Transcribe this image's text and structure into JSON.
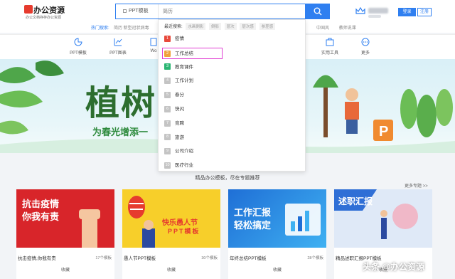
{
  "header": {
    "logo_text": "办公资源",
    "logo_sub": "办公文档存存办公资源",
    "search_category": "PPT模板",
    "search_placeholder": "简历",
    "login_label": "登录",
    "register_label": "注册"
  },
  "hot_search": {
    "label": "热门搜索:",
    "items": "简历  新型冠状病毒",
    "right_items": [
      "中国风",
      "教师说课"
    ]
  },
  "nav": {
    "items": [
      {
        "label": "PPT模板",
        "icon": "ppt-icon"
      },
      {
        "label": "PPT图表",
        "icon": "chart-icon"
      },
      {
        "label": "Wo",
        "icon": "word-icon"
      },
      {
        "label": "实用工具",
        "icon": "tools-icon"
      },
      {
        "label": "更多",
        "icon": "more-icon"
      }
    ]
  },
  "dropdown": {
    "recent_label": "最近搜索:",
    "recent_tags": [
      "水画倒影",
      "倒影",
      "层次",
      "层次感",
      "参差感"
    ],
    "items": [
      {
        "num": "1",
        "label": "疫情",
        "color": "#e84a3c"
      },
      {
        "num": "2",
        "label": "工作总结",
        "color": "#f0a23a"
      },
      {
        "num": "3",
        "label": "教育课件",
        "color": "#2bb673"
      },
      {
        "num": "4",
        "label": "工作计划",
        "color": "#c4c4c4"
      },
      {
        "num": "5",
        "label": "春分",
        "color": "#c4c4c4"
      },
      {
        "num": "6",
        "label": "快闪",
        "color": "#c4c4c4"
      },
      {
        "num": "7",
        "label": "竞聘",
        "color": "#c4c4c4"
      },
      {
        "num": "8",
        "label": "旅游",
        "color": "#c4c4c4"
      },
      {
        "num": "9",
        "label": "公司介绍",
        "color": "#c4c4c4"
      },
      {
        "num": "10",
        "label": "医疗行业",
        "color": "#c4c4c4"
      }
    ]
  },
  "banner": {
    "title": "植树",
    "subtitle": "为春光增添一"
  },
  "section": {
    "title": "精品办公模板，尽在专题推荐",
    "more": "更多专题 >>"
  },
  "cards": [
    {
      "name": "抗击疫情,你我有责",
      "count": "17个模板",
      "fav": "收藏",
      "img_line1": "抗击疫情",
      "img_line2": "你我有责"
    },
    {
      "name": "愚人节PPT模板",
      "count": "30个模板",
      "fav": "收藏",
      "img_line1": "快乐愚人节",
      "img_line2": "PPT模板"
    },
    {
      "name": "年终总结PPT模板",
      "count": "28个模板",
      "fav": "收藏",
      "img_line1": "工作汇报",
      "img_line2": "轻松搞定"
    },
    {
      "name": "精品述职汇报PPT模板",
      "count": "",
      "fav": "收藏",
      "img_line1": "述职汇报",
      "img_line2": ""
    }
  ],
  "watermark": "头条 @办公资源",
  "colors": {
    "accent": "#2f7ff0",
    "highlight_border": "#e03fd3"
  }
}
